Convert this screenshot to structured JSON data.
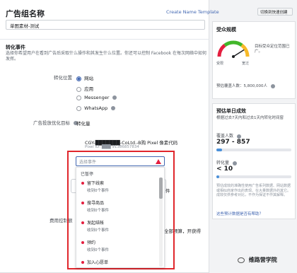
{
  "header": {
    "title": "广告组名称",
    "create_template_link": "Create Name Template",
    "switch_button": "切换到快速创建"
  },
  "adset_name": {
    "value": "单图素材-测试"
  },
  "conversion": {
    "section_title": "转化事件",
    "description": "选择你希望用户在看到广告后采取什么操作和其发生什么位置。你还可以控制 Facebook 在每次网络中如何发挥。",
    "location_label": "转化位置",
    "locations": [
      {
        "label": "网站",
        "selected": true
      },
      {
        "label": "应用",
        "selected": false
      },
      {
        "label": "Messenger",
        "selected": false
      },
      {
        "label": "WhatsApp",
        "selected": false
      }
    ],
    "optimization_label": "广告投放优化目标",
    "optimization_value": "转化量",
    "pixel_name": "CGY-███████-CoLtd.-B购 Pixel 像素代码",
    "pixel_id": "Pixel ID: ███ 91386857834",
    "event_search_placeholder": "选择事件",
    "dropdown_group": "已暂停",
    "events": [
      {
        "name": "留下线索",
        "status": "收到0个事件",
        "color": "#e41e3f"
      },
      {
        "name": "搜寻商品",
        "status": "收到0个事件",
        "color": "#e41e3f"
      },
      {
        "name": "发起结帐",
        "status": "收到0个事件",
        "color": "#e41e3f"
      },
      {
        "name": "预约",
        "status": "收到0个事件",
        "color": "#e41e3f"
      },
      {
        "name": "加入心愿单",
        "status": "",
        "color": "#e41e3f"
      }
    ],
    "cost_control_label": "费用控制额",
    "side_fragment_1": "件",
    "side_fragment_2": "全部预算，开获得"
  },
  "audience": {
    "title": "受众规模",
    "gauge_low": "受限",
    "gauge_high": "宽泛",
    "gauge_level": 0.82,
    "gauge_desc": "目标受众定位范围已广。",
    "estimate_text": "预估覆盖人数：5,800,000人"
  },
  "daily": {
    "title": "预估单日成效",
    "desc": "根据过去7天内和过去1天内转化时间窗",
    "reach_label": "覆盖人数",
    "reach_range": "297 - 857",
    "reach_level": 0.08,
    "conv_label": "转化量",
    "conv_value": "< 10",
    "conv_level": 0.04,
    "note": "预估成效的准确性使用广告系列数据、网站数据或相似商家作出的表现、在大量数据外的其它。成效仅供参考对比，不作为保证不作其解释。",
    "feedback_link": "这些预计数据是否有帮助？"
  },
  "watermark": {
    "text": "维路营学院"
  },
  "colors": {
    "link": "#4267b2",
    "highlight": "#e0262c",
    "gauge_green": "#42b72a",
    "gauge_yellow": "#f7b928",
    "gauge_red": "#e41e3f",
    "bar_fill": "#4a90d9"
  }
}
